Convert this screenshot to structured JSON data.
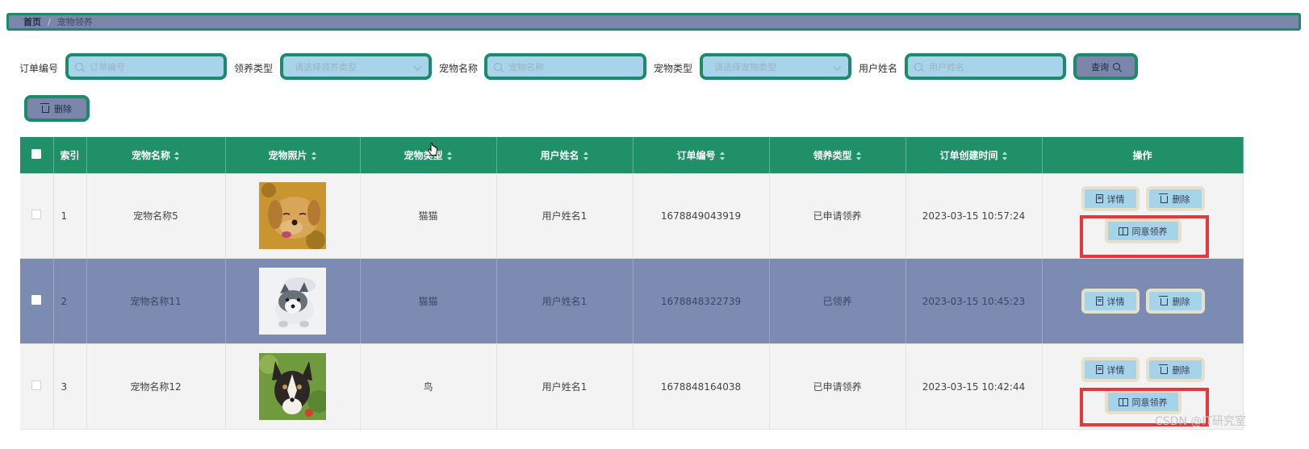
{
  "breadcrumb": {
    "home": "首页",
    "separator": "/",
    "current": "宠物领养"
  },
  "search": {
    "order_no_label": "订单编号",
    "order_no_placeholder": "订单编号",
    "adopt_type_label": "领养类型",
    "adopt_type_placeholder": "请选择领养类型",
    "pet_name_label": "宠物名称",
    "pet_name_placeholder": "宠物名称",
    "pet_type_label": "宠物类型",
    "pet_type_placeholder": "请选择宠物类型",
    "user_name_label": "用户姓名",
    "user_name_placeholder": "用户姓名",
    "query_label": "查询"
  },
  "toolbar": {
    "delete_label": "删除"
  },
  "table": {
    "headers": {
      "index": "索引",
      "pet_name": "宠物名称",
      "pet_photo": "宠物照片",
      "pet_type": "宠物类型",
      "user_name": "用户姓名",
      "order_no": "订单编号",
      "adopt_type": "领养类型",
      "created": "订单创建时间",
      "ops": "操作"
    },
    "rows": [
      {
        "index": "1",
        "pet_name": "宠物名称5",
        "pet_type": "猫猫",
        "user_name": "用户姓名1",
        "order_no": "1678849043919",
        "adopt_type": "已申请领养",
        "created": "2023-03-15 10:57:24"
      },
      {
        "index": "2",
        "pet_name": "宠物名称11",
        "pet_type": "猫猫",
        "user_name": "用户姓名1",
        "order_no": "1678848322739",
        "adopt_type": "已领养",
        "created": "2023-03-15 10:45:23"
      },
      {
        "index": "3",
        "pet_name": "宠物名称12",
        "pet_type": "鸟",
        "user_name": "用户姓名1",
        "order_no": "1678848164038",
        "adopt_type": "已申请领养",
        "created": "2023-03-15 10:42:44"
      }
    ],
    "actions": {
      "detail": "详情",
      "delete": "删除",
      "approve": "同意领养"
    }
  },
  "watermark": "CSDN @IT研究室",
  "colors": {
    "header_green": "#1f9068",
    "field_border": "#1b8c6a",
    "field_bg": "#a7d4ea",
    "highlight_row": "#7c8bb1",
    "annotation_red": "#e8363b"
  }
}
